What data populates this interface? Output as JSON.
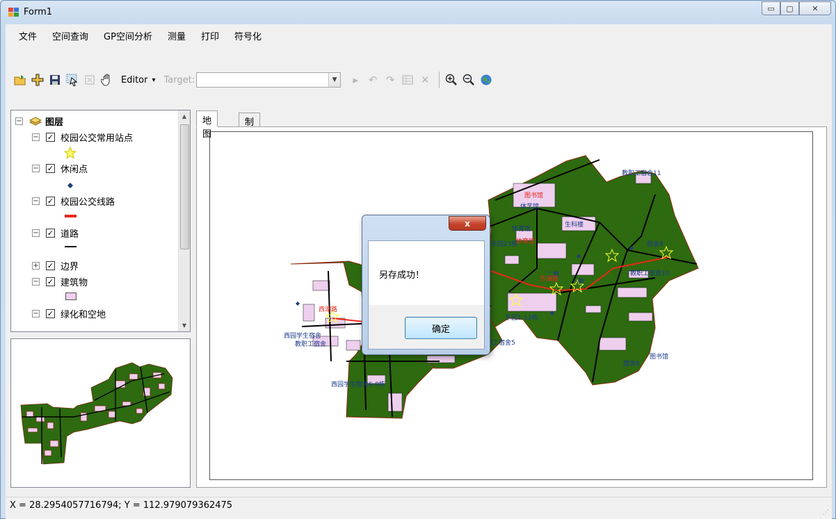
{
  "window": {
    "title": "Form1",
    "minimize_glyph": "▭",
    "maximize_glyph": "▢",
    "close_glyph": "✕"
  },
  "menu": [
    "文件",
    "空间查询",
    "GP空间分析",
    "测量",
    "打印",
    "符号化"
  ],
  "toolbar": {
    "editor_label": "Editor",
    "editor_arrow": "▾",
    "target_label": "Target:",
    "target_value": "",
    "icons": [
      "open-icon",
      "add-data-icon",
      "save-icon",
      "select-icon",
      "identify-icon",
      "pan-icon",
      "edit-tool-icon",
      "undo-icon",
      "redo-icon",
      "attributes-icon",
      "delete-icon",
      "zoom-in-icon",
      "zoom-out-icon",
      "full-extent-icon"
    ]
  },
  "toc": {
    "root_label": "图层",
    "layers": [
      {
        "name": "校园公交常用站点",
        "checked": true,
        "expanded": true,
        "symbol": "star"
      },
      {
        "name": "休闲点",
        "checked": true,
        "expanded": true,
        "symbol": "diamond"
      },
      {
        "name": "校园公交线路",
        "checked": true,
        "expanded": true,
        "symbol": "red-line"
      },
      {
        "name": "道路",
        "checked": true,
        "expanded": true,
        "symbol": "black-line"
      },
      {
        "name": "边界",
        "checked": true,
        "expanded": false,
        "symbol": ""
      },
      {
        "name": "建筑物",
        "checked": true,
        "expanded": true,
        "symbol": "pink-box"
      },
      {
        "name": "绿化和空地",
        "checked": true,
        "expanded": true,
        "symbol": ""
      }
    ]
  },
  "tabs": [
    {
      "label": "地图",
      "active": true
    },
    {
      "label": "制版",
      "active": false
    }
  ],
  "map_labels": {
    "blue": [
      "教职工宿舍11",
      "体艺馆",
      "生科楼",
      "二教",
      "一教",
      "教职工宿舍10",
      "宿舍6",
      "西园学生宿舍6-8栋",
      "教职工宿舍5",
      "东园1-12栋",
      "西园学生宿舍",
      "教职工宿舍",
      "东园23栋",
      "图书馆",
      "体育馆",
      "宿舍8"
    ],
    "red": [
      "图书馆",
      "体育馆",
      "东湖路",
      "西湖路"
    ]
  },
  "colors": {
    "green": "#2d6a10",
    "building": "#eed0ee",
    "route": "#e8281a",
    "outline": "#8a2a10"
  },
  "dialog": {
    "message": "另存成功！",
    "ok_label": "确定",
    "close_glyph": "x"
  },
  "status": {
    "text": "X = 28.2954057716794;  Y = 112.979079362475"
  }
}
